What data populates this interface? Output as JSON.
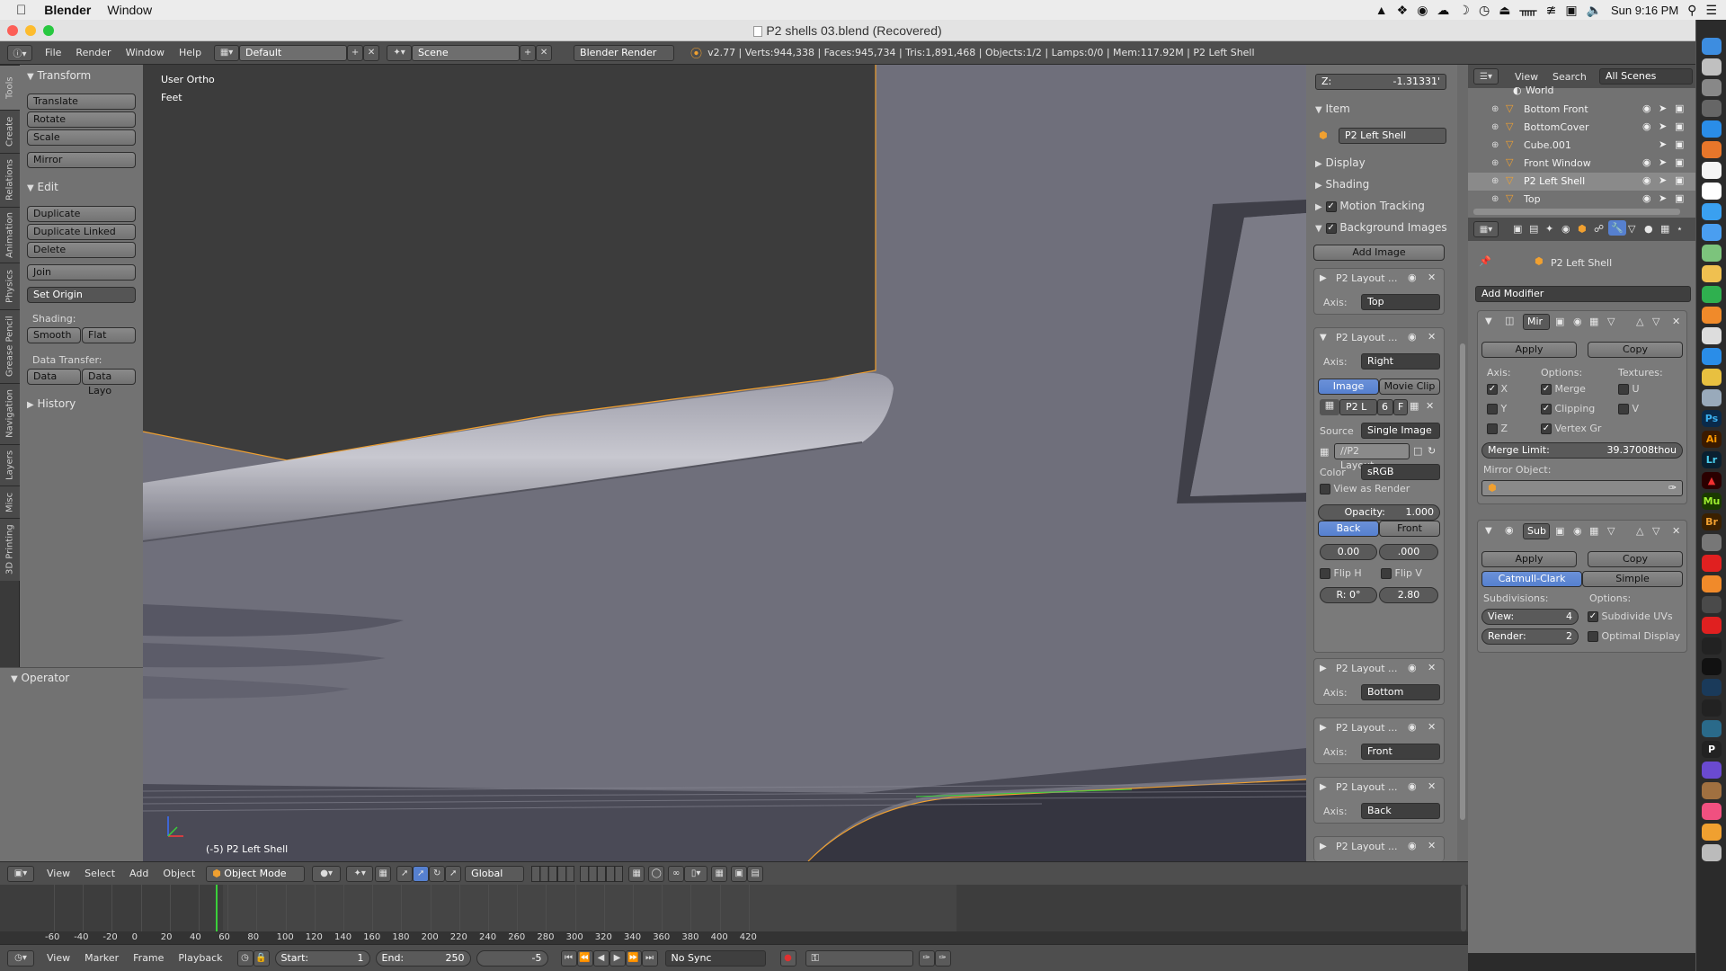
{
  "macos": {
    "app_name": "Blender",
    "menu_window": "Window",
    "clock": "Sun 9:16 PM"
  },
  "window": {
    "title": "P2 shells 03.blend (Recovered)"
  },
  "info_header": {
    "menus": [
      "File",
      "Render",
      "Window",
      "Help"
    ],
    "layout": "Default",
    "scene": "Scene",
    "engine": "Blender Render",
    "stats": "v2.77 | Verts:944,338 | Faces:945,734 | Tris:1,891,468 | Objects:1/2 | Lamps:0/0 | Mem:117.92M | P2 Left Shell"
  },
  "tool_tabs": [
    "Tools",
    "Create",
    "Relations",
    "Animation",
    "Physics",
    "Grease Pencil",
    "Navigation",
    "Layers",
    "Misc",
    "3D Printing"
  ],
  "tools": {
    "transform_header": "Transform",
    "translate": "Translate",
    "rotate": "Rotate",
    "scale": "Scale",
    "mirror": "Mirror",
    "edit_header": "Edit",
    "duplicate": "Duplicate",
    "duplicate_linked": "Duplicate Linked",
    "delete": "Delete",
    "join": "Join",
    "set_origin": "Set Origin",
    "shading_label": "Shading:",
    "smooth": "Smooth",
    "flat": "Flat",
    "data_transfer_label": "Data Transfer:",
    "data": "Data",
    "data_layo": "Data Layo",
    "history_header": "History",
    "operator_header": "Operator"
  },
  "viewport": {
    "view_name": "User Ortho",
    "units": "Feet",
    "object_label": "(-5) P2 Left Shell"
  },
  "view_props": {
    "z_field": "Z:",
    "z_value": "-1.31331'",
    "item_header": "Item",
    "item_name": "P2 Left Shell",
    "display": "Display",
    "shading": "Shading",
    "motion_tracking": "Motion Tracking",
    "background_images": "Background Images",
    "add_image": "Add Image",
    "bg1_name": "P2 Layout ...",
    "axis_label": "Axis:",
    "bg1_axis": "Top",
    "bg2_name": "P2 Layout ...",
    "bg2_axis": "Right",
    "image_tab": "Image",
    "movie_clip_tab": "Movie Clip",
    "img_name": "P2 L",
    "img_users": "6",
    "img_f": "F",
    "source_label": "Source",
    "source_value": "Single Image",
    "path_value": "//P2 Layout...",
    "color_label": "Color",
    "color_value": "sRGB",
    "view_as_render": "View as Render",
    "opacity": "Opacity:",
    "opacity_value": "1.000",
    "back": "Back",
    "front": "Front",
    "off_x": "0.00",
    "off_y": ".000",
    "flip_h": "Flip H",
    "flip_v": "Flip V",
    "rotation": "R: 0°",
    "size": "2.80",
    "bg3_name": "P2 Layout ...",
    "bg3_axis": "Bottom",
    "bg4_name": "P2 Layout ...",
    "bg4_axis": "Front",
    "bg5_name": "P2 Layout ...",
    "bg5_axis": "Back",
    "bg6_name": "P2 Layout ..."
  },
  "outliner": {
    "menus": [
      "View",
      "Search"
    ],
    "filter": "All Scenes",
    "items": [
      "World",
      "Bottom Front",
      "BottomCover",
      "Cube.001",
      "Front Window",
      "P2 Left Shell",
      "Top"
    ]
  },
  "modifiers": {
    "object_name": "P2 Left Shell",
    "add_modifier": "Add Modifier",
    "mirror_name": "Mir",
    "apply": "Apply",
    "copy": "Copy",
    "axis_label": "Axis:",
    "options_label": "Options:",
    "textures_label": "Textures:",
    "x": "X",
    "y": "Y",
    "z": "Z",
    "merge": "Merge",
    "clipping": "Clipping",
    "vertex_gr": "Vertex Gr",
    "u": "U",
    "v": "V",
    "merge_limit_label": "Merge Limit:",
    "merge_limit_value": "39.37008thou",
    "mirror_object": "Mirror Object:",
    "subsurf_name": "Sub",
    "catmull": "Catmull-Clark",
    "simple": "Simple",
    "subdivisions": "Subdivisions:",
    "options2": "Options:",
    "view_label": "View:",
    "view_value": "4",
    "render_label": "Render:",
    "render_value": "2",
    "subdivide_uvs": "Subdivide UVs",
    "optimal_display": "Optimal Display"
  },
  "view3d_header": {
    "menus": [
      "View",
      "Select",
      "Add",
      "Object"
    ],
    "mode": "Object Mode",
    "orientation": "Global"
  },
  "timeline": {
    "ticks": [
      "-60",
      "-40",
      "-20",
      "0",
      "20",
      "40",
      "60",
      "80",
      "100",
      "120",
      "140",
      "160",
      "180",
      "200",
      "220",
      "240",
      "260",
      "280",
      "300",
      "320",
      "340",
      "360",
      "380",
      "400",
      "420"
    ],
    "current_frame": 0
  },
  "timeline_header": {
    "menus": [
      "View",
      "Marker",
      "Frame",
      "Playback"
    ],
    "start_label": "Start:",
    "start_value": "1",
    "end_label": "End:",
    "end_value": "250",
    "current": "-5",
    "sync": "No Sync"
  },
  "dock_labels": {
    "ps": "Ps",
    "ai": "Ai",
    "lr": "Lr",
    "mu": "Mu",
    "br": "Br",
    "p": "P"
  },
  "colors": {
    "selected_blue": "#5680cf",
    "outline_orange": "#f0a030",
    "viewport_bg": "#6f6f7b"
  }
}
